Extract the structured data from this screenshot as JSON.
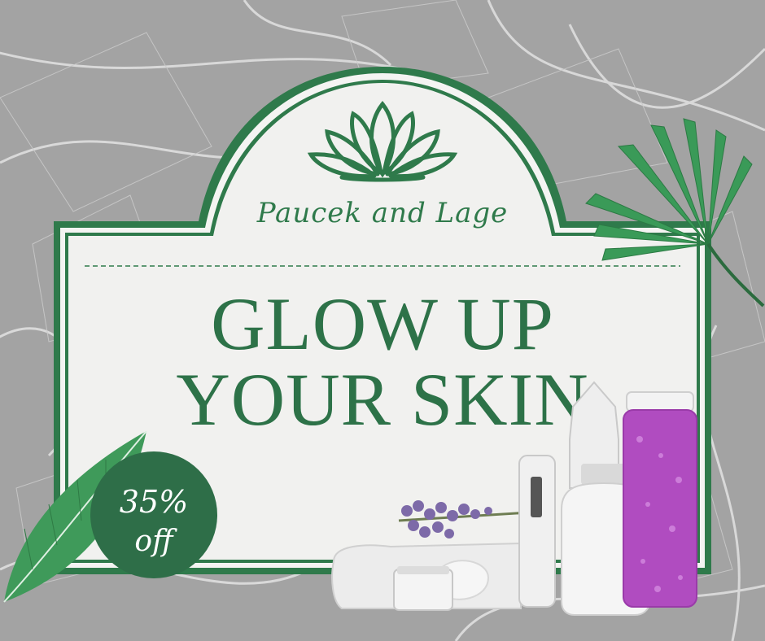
{
  "brand": {
    "name": "Paucek and Lage"
  },
  "headline": {
    "line1": "GLOW UP",
    "line2": "YOUR SKIN"
  },
  "badge": {
    "percent": "35%",
    "label": "off"
  },
  "colors": {
    "primary_green": "#2e6e48",
    "frame_green": "#2f7a4b",
    "panel": "#f1f1ef",
    "background": "#9a9a9a"
  },
  "icons": [
    "lotus-icon",
    "palm-leaf-icon",
    "green-leaf-icon"
  ]
}
